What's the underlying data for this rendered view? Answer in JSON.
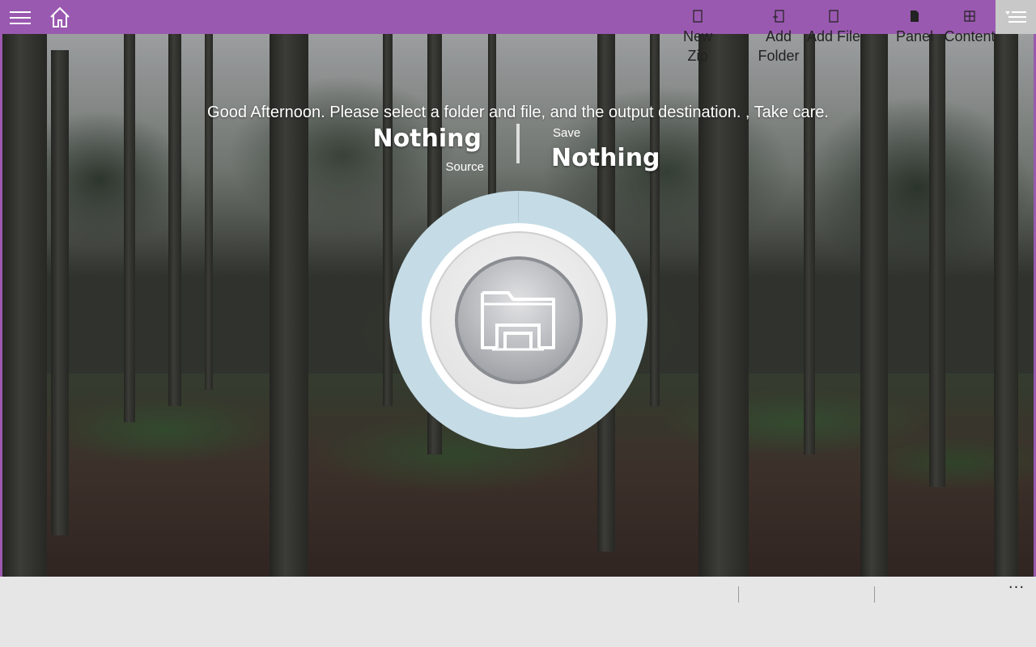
{
  "header": {
    "menu_icon": "hamburger-icon",
    "home_icon": "home-icon",
    "right_menu_icon": "list-menu-icon",
    "accent_color": "#9a59b0"
  },
  "main": {
    "greeting": "Good Afternoon. Please select a folder and file, and the output destination. , Take care.",
    "source": {
      "value": "Nothing",
      "label": "Source"
    },
    "save": {
      "value": "Nothing",
      "label": "Save"
    },
    "center_icon": "folder-icon",
    "ring_color": "#c5dce6"
  },
  "commandbar": {
    "items": [
      {
        "label_line1": "New",
        "label_line2": "Zip",
        "icon": "new-zip-icon"
      },
      {
        "label_line1": "Add",
        "label_line2": "Folder",
        "icon": "add-folder-icon"
      },
      {
        "label": "Add File",
        "icon": "add-file-icon"
      },
      {
        "label": "Panel",
        "icon": "panel-icon"
      },
      {
        "label": "Content",
        "icon": "content-icon"
      }
    ],
    "more": "···"
  }
}
